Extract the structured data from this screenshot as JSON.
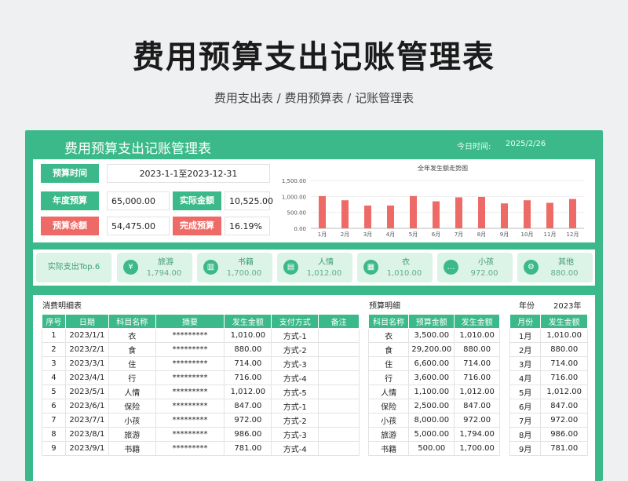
{
  "page": {
    "title": "费用预算支出记账管理表",
    "subtitle": "费用支出表 / 费用预算表 / 记账管理表"
  },
  "header": {
    "title": "费用预算支出记账管理表",
    "date_label": "今日时间:",
    "date_value": "2025/2/26"
  },
  "summary": {
    "budget_period_label": "预算时间",
    "budget_period_value": "2023-1-1至2023-12-31",
    "annual_budget_label": "年度预算",
    "annual_budget_value": "65,000.00",
    "actual_amount_label": "实际金额",
    "actual_amount_value": "10,525.00",
    "budget_balance_label": "预算余额",
    "budget_balance_value": "54,475.00",
    "completion_label": "完成预算",
    "completion_value": "16.19%"
  },
  "chart_data": {
    "type": "bar",
    "title": "全年发生额走势图",
    "categories": [
      "1月",
      "2月",
      "3月",
      "4月",
      "5月",
      "6月",
      "7月",
      "8月",
      "9月",
      "10月",
      "11月",
      "12月"
    ],
    "values": [
      1010,
      880,
      714,
      716,
      1012,
      847,
      972,
      986,
      781,
      880,
      800,
      920
    ],
    "ylim": [
      0,
      1500
    ],
    "yticks": [
      "0.00",
      "500.00",
      "1,000.00",
      "1,500.00"
    ],
    "bar_color": "#ee6a66"
  },
  "top6": {
    "label": "实际支出Top.6",
    "items": [
      {
        "name": "旅游",
        "value": "1,794.00",
        "icon": "money-icon"
      },
      {
        "name": "书籍",
        "value": "1,700.00",
        "icon": "book-icon"
      },
      {
        "name": "人情",
        "value": "1,012.00",
        "icon": "chart-icon"
      },
      {
        "name": "衣",
        "value": "1,010.00",
        "icon": "shirt-icon"
      },
      {
        "name": "小孩",
        "value": "972.00",
        "icon": "chat-icon"
      },
      {
        "name": "其他",
        "value": "880.00",
        "icon": "gear-icon"
      }
    ]
  },
  "expense": {
    "label": "消费明细表",
    "columns": [
      "序号",
      "日期",
      "科目名称",
      "摘要",
      "发生金额",
      "支付方式",
      "备注"
    ],
    "rows": [
      [
        "1",
        "2023/1/1",
        "衣",
        "*********",
        "1,010.00",
        "方式-1",
        ""
      ],
      [
        "2",
        "2023/2/1",
        "食",
        "*********",
        "880.00",
        "方式-2",
        ""
      ],
      [
        "3",
        "2023/3/1",
        "住",
        "*********",
        "714.00",
        "方式-3",
        ""
      ],
      [
        "4",
        "2023/4/1",
        "行",
        "*********",
        "716.00",
        "方式-4",
        ""
      ],
      [
        "5",
        "2023/5/1",
        "人情",
        "*********",
        "1,012.00",
        "方式-5",
        ""
      ],
      [
        "6",
        "2023/6/1",
        "保险",
        "*********",
        "847.00",
        "方式-1",
        ""
      ],
      [
        "7",
        "2023/7/1",
        "小孩",
        "*********",
        "972.00",
        "方式-2",
        ""
      ],
      [
        "8",
        "2023/8/1",
        "旅游",
        "*********",
        "986.00",
        "方式-3",
        ""
      ],
      [
        "9",
        "2023/9/1",
        "书籍",
        "*********",
        "781.00",
        "方式-4",
        ""
      ]
    ]
  },
  "budget": {
    "label": "预算明细",
    "columns": [
      "科目名称",
      "预算金额",
      "发生金额"
    ],
    "rows": [
      [
        "衣",
        "3,500.00",
        "1,010.00"
      ],
      [
        "食",
        "29,200.00",
        "880.00"
      ],
      [
        "住",
        "6,600.00",
        "714.00"
      ],
      [
        "行",
        "3,600.00",
        "716.00"
      ],
      [
        "人情",
        "1,100.00",
        "1,012.00"
      ],
      [
        "保险",
        "2,500.00",
        "847.00"
      ],
      [
        "小孩",
        "8,000.00",
        "972.00"
      ],
      [
        "旅游",
        "5,000.00",
        "1,794.00"
      ],
      [
        "书籍",
        "500.00",
        "1,700.00"
      ]
    ]
  },
  "monthly": {
    "year_label": "年份",
    "year_value": "2023年",
    "columns": [
      "月份",
      "发生金额"
    ],
    "rows": [
      [
        "1月",
        "1,010.00"
      ],
      [
        "2月",
        "880.00"
      ],
      [
        "3月",
        "714.00"
      ],
      [
        "4月",
        "716.00"
      ],
      [
        "5月",
        "1,012.00"
      ],
      [
        "6月",
        "847.00"
      ],
      [
        "7月",
        "972.00"
      ],
      [
        "8月",
        "986.00"
      ],
      [
        "9月",
        "781.00"
      ]
    ]
  }
}
